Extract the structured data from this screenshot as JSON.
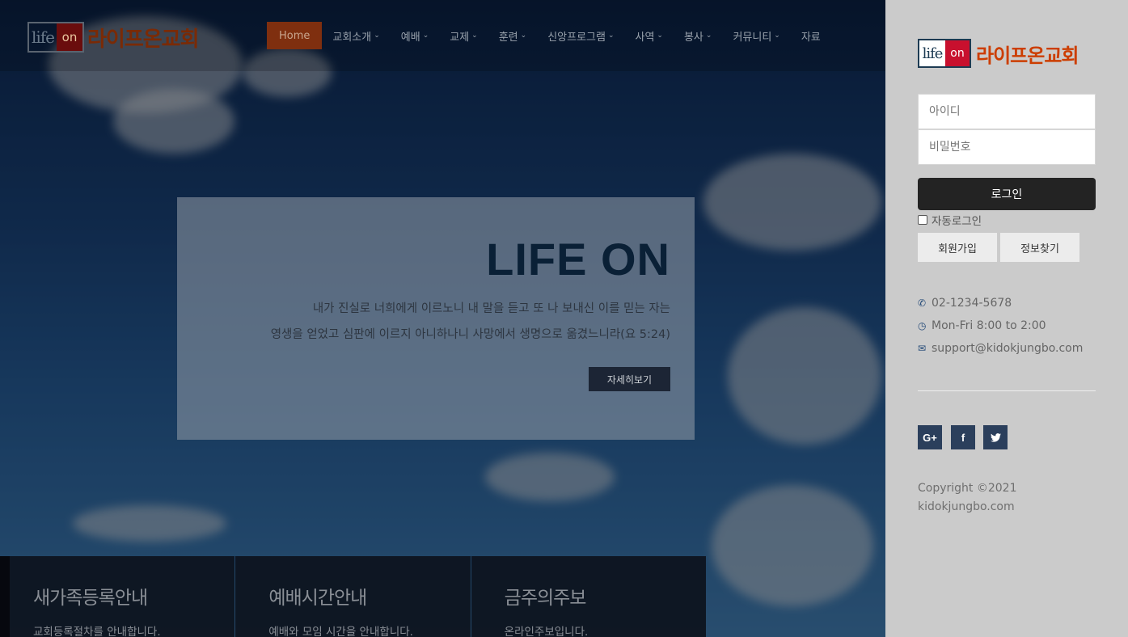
{
  "header": {
    "logo_life": "life",
    "logo_on": "on",
    "logo_text": "라이프온교회",
    "nav": [
      {
        "label": "Home",
        "active": true
      },
      {
        "label": "교회소개"
      },
      {
        "label": "예배"
      },
      {
        "label": "교제"
      },
      {
        "label": "훈련"
      },
      {
        "label": "신앙프로그램"
      },
      {
        "label": "사역"
      },
      {
        "label": "봉사"
      },
      {
        "label": "커뮤니티"
      },
      {
        "label": "자료"
      }
    ]
  },
  "hero": {
    "title": "LIFE ON",
    "verse_line1": "내가 진실로 너희에게 이르노니 내 말을 듣고 또 나 보내신 이를 믿는 자는",
    "verse_line2": "영생을 얻었고 심판에 이르지 아니하나니 사망에서 생명으로 옮겼느니라(요 5:24)",
    "button": "자세히보기"
  },
  "info_cards": [
    {
      "title": "새가족등록안내",
      "subtitle": "교회등록절차를 안내합니다."
    },
    {
      "title": "예배시간안내",
      "subtitle": "예배와 모임 시간을 안내합니다."
    },
    {
      "title": "금주의주보",
      "subtitle": "온라인주보입니다."
    }
  ],
  "sidebar": {
    "logo_life": "life",
    "logo_on": "on",
    "logo_text": "라이프온교회",
    "id_placeholder": "아이디",
    "pw_placeholder": "비밀번호",
    "login_button": "로그인",
    "auto_login": "자동로그인",
    "join_button": "회원가입",
    "find_button": "정보찾기",
    "phone": "02-1234-5678",
    "hours": "Mon-Fri 8:00 to 2:00",
    "email": "support@kidokjungbo.com",
    "social": [
      {
        "name": "google-plus-icon",
        "glyph": "G+"
      },
      {
        "name": "facebook-icon",
        "glyph": "f"
      },
      {
        "name": "twitter-icon",
        "glyph": "🐦"
      }
    ],
    "copyright_line1": "Copyright ©2021",
    "copyright_line2": "kidokjungbo.com"
  },
  "colors": {
    "accent": "#cc3d00",
    "nav_active": "#7f2f0f",
    "sidebar_bg": "#cbcbcb",
    "social_bg": "#2b3f5c"
  }
}
